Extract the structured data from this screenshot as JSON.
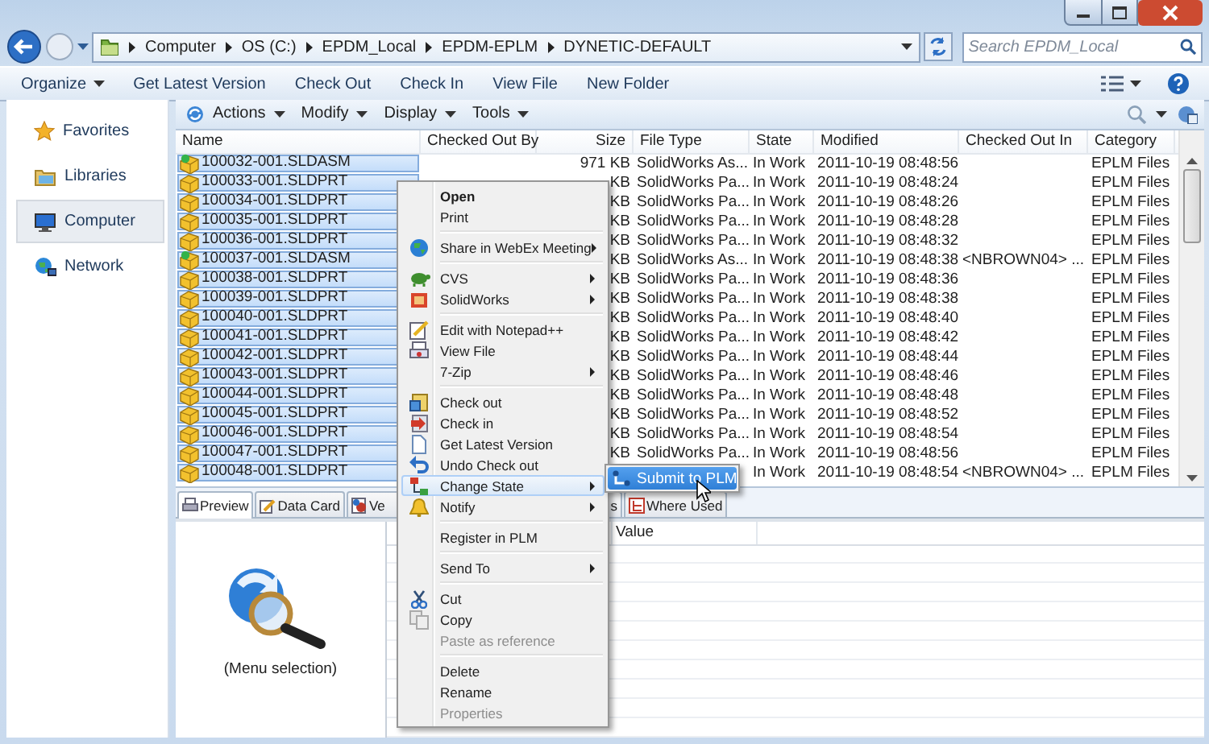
{
  "window": {
    "breadcrumb": [
      "Computer",
      "OS (C:)",
      "EPDM_Local",
      "EPDM-EPLM",
      "DYNETIC-DEFAULT"
    ],
    "search": {
      "placeholder": "Search EPDM_Local"
    }
  },
  "command_bar": [
    {
      "label": "Organize",
      "dropdown": true
    },
    {
      "label": "Get Latest Version",
      "dropdown": false
    },
    {
      "label": "Check Out",
      "dropdown": false
    },
    {
      "label": "Check In",
      "dropdown": false
    },
    {
      "label": "View File",
      "dropdown": false
    },
    {
      "label": "New Folder",
      "dropdown": false
    }
  ],
  "nav": [
    {
      "label": "Favorites",
      "selected": false
    },
    {
      "label": "Libraries",
      "selected": false
    },
    {
      "label": "Computer",
      "selected": true
    },
    {
      "label": "Network",
      "selected": false
    }
  ],
  "pdm_toolbar": [
    "Actions",
    "Modify",
    "Display",
    "Tools"
  ],
  "table": {
    "columns": [
      "Name",
      "Checked Out By",
      "Size",
      "File Type",
      "State",
      "Modified",
      "Checked Out In",
      "Category"
    ],
    "rows": [
      {
        "name": "100032-001.SLDASM",
        "kind": "assembly",
        "selected": true,
        "size": "971 KB",
        "file_type": "SolidWorks As...",
        "state": "In Work",
        "modified": "2011-10-19 08:48:56",
        "category": "EPLM Files"
      },
      {
        "name": "100033-001.SLDPRT",
        "kind": "part",
        "selected": true,
        "size": "KB",
        "file_type": "SolidWorks Pa...",
        "state": "In Work",
        "modified": "2011-10-19 08:48:24",
        "category": "EPLM Files"
      },
      {
        "name": "100034-001.SLDPRT",
        "kind": "part",
        "selected": true,
        "size": "KB",
        "file_type": "SolidWorks Pa...",
        "state": "In Work",
        "modified": "2011-10-19 08:48:26",
        "category": "EPLM Files"
      },
      {
        "name": "100035-001.SLDPRT",
        "kind": "part",
        "selected": true,
        "size": "KB",
        "file_type": "SolidWorks Pa...",
        "state": "In Work",
        "modified": "2011-10-19 08:48:28",
        "category": "EPLM Files"
      },
      {
        "name": "100036-001.SLDPRT",
        "kind": "part",
        "selected": true,
        "size": "KB",
        "file_type": "SolidWorks Pa...",
        "state": "In Work",
        "modified": "2011-10-19 08:48:32",
        "category": "EPLM Files"
      },
      {
        "name": "100037-001.SLDASM",
        "kind": "assembly",
        "selected": true,
        "size": "KB",
        "file_type": "SolidWorks As...",
        "state": "In Work",
        "modified": "2011-10-19 08:48:38",
        "checked_out_in": "<NBROWN04> ...",
        "category": "EPLM Files"
      },
      {
        "name": "100038-001.SLDPRT",
        "kind": "part",
        "selected": true,
        "size": "KB",
        "file_type": "SolidWorks Pa...",
        "state": "In Work",
        "modified": "2011-10-19 08:48:36",
        "category": "EPLM Files"
      },
      {
        "name": "100039-001.SLDPRT",
        "kind": "part",
        "selected": true,
        "size": "KB",
        "file_type": "SolidWorks Pa...",
        "state": "In Work",
        "modified": "2011-10-19 08:48:38",
        "category": "EPLM Files"
      },
      {
        "name": "100040-001.SLDPRT",
        "kind": "part",
        "selected": true,
        "size": "KB",
        "file_type": "SolidWorks Pa...",
        "state": "In Work",
        "modified": "2011-10-19 08:48:40",
        "category": "EPLM Files"
      },
      {
        "name": "100041-001.SLDPRT",
        "kind": "part",
        "selected": true,
        "size": "KB",
        "file_type": "SolidWorks Pa...",
        "state": "In Work",
        "modified": "2011-10-19 08:48:42",
        "category": "EPLM Files"
      },
      {
        "name": "100042-001.SLDPRT",
        "kind": "part",
        "selected": true,
        "size": "KB",
        "file_type": "SolidWorks Pa...",
        "state": "In Work",
        "modified": "2011-10-19 08:48:44",
        "category": "EPLM Files"
      },
      {
        "name": "100043-001.SLDPRT",
        "kind": "part",
        "selected": true,
        "size": "KB",
        "file_type": "SolidWorks Pa...",
        "state": "In Work",
        "modified": "2011-10-19 08:48:46",
        "category": "EPLM Files"
      },
      {
        "name": "100044-001.SLDPRT",
        "kind": "part",
        "selected": true,
        "size": "KB",
        "file_type": "SolidWorks Pa...",
        "state": "In Work",
        "modified": "2011-10-19 08:48:48",
        "category": "EPLM Files"
      },
      {
        "name": "100045-001.SLDPRT",
        "kind": "part",
        "selected": true,
        "size": "KB",
        "file_type": "SolidWorks Pa...",
        "state": "In Work",
        "modified": "2011-10-19 08:48:52",
        "category": "EPLM Files"
      },
      {
        "name": "100046-001.SLDPRT",
        "kind": "part",
        "selected": true,
        "size": "KB",
        "file_type": "SolidWorks Pa...",
        "state": "In Work",
        "modified": "2011-10-19 08:48:54",
        "category": "EPLM Files"
      },
      {
        "name": "100047-001.SLDPRT",
        "kind": "part",
        "selected": true,
        "size": "KB",
        "file_type": "SolidWorks Pa...",
        "state": "In Work",
        "modified": "2011-10-19 08:48:56",
        "category": "EPLM Files"
      },
      {
        "name": "100048-001.SLDPRT",
        "kind": "part",
        "selected": true,
        "state": "In Work",
        "modified": "2011-10-19 08:48:54",
        "checked_out_in": "<NBROWN04> ...",
        "category": "EPLM Files"
      }
    ]
  },
  "bottom_panel": {
    "tabs": [
      {
        "label": "Preview",
        "selected": true
      },
      {
        "label": "Data Card",
        "selected": false
      },
      {
        "label": "Ve",
        "selected": false
      },
      {
        "label": "s",
        "selected": false
      },
      {
        "label": "Where Used",
        "selected": false
      }
    ],
    "preview_caption": "(Menu selection)",
    "value_column": "Value"
  },
  "context_menu": {
    "groups": [
      [
        {
          "label": "Open",
          "default": true,
          "disabled": false,
          "submenu": false,
          "selected": false
        },
        {
          "label": "Print",
          "default": false,
          "disabled": false,
          "submenu": false,
          "selected": false
        }
      ],
      [
        {
          "label": "Share in WebEx Meeting",
          "default": false,
          "disabled": false,
          "submenu": true,
          "selected": false
        }
      ],
      [
        {
          "label": "CVS",
          "default": false,
          "disabled": false,
          "submenu": true,
          "selected": false
        },
        {
          "label": "SolidWorks",
          "default": false,
          "disabled": false,
          "submenu": true,
          "selected": false
        }
      ],
      [
        {
          "label": "Edit with Notepad++",
          "default": false,
          "disabled": false,
          "submenu": false,
          "selected": false
        },
        {
          "label": "View File",
          "default": false,
          "disabled": false,
          "submenu": false,
          "selected": false
        },
        {
          "label": "7-Zip",
          "default": false,
          "disabled": false,
          "submenu": true,
          "selected": false
        }
      ],
      [
        {
          "label": "Check out",
          "default": false,
          "disabled": false,
          "submenu": false,
          "selected": false
        },
        {
          "label": "Check in",
          "default": false,
          "disabled": false,
          "submenu": false,
          "selected": false
        },
        {
          "label": "Get Latest Version",
          "default": false,
          "disabled": false,
          "submenu": false,
          "selected": false
        },
        {
          "label": "Undo Check out",
          "default": false,
          "disabled": false,
          "submenu": false,
          "selected": false
        },
        {
          "label": "Change State",
          "default": false,
          "disabled": false,
          "submenu": true,
          "selected": true
        },
        {
          "label": "Notify",
          "default": false,
          "disabled": false,
          "submenu": true,
          "selected": false
        }
      ],
      [
        {
          "label": "Register in PLM",
          "default": false,
          "disabled": false,
          "submenu": false,
          "selected": false
        }
      ],
      [
        {
          "label": "Send To",
          "default": false,
          "disabled": false,
          "submenu": true,
          "selected": false
        }
      ],
      [
        {
          "label": "Cut",
          "default": false,
          "disabled": false,
          "submenu": false,
          "selected": false
        },
        {
          "label": "Copy",
          "default": false,
          "disabled": false,
          "submenu": false,
          "selected": false
        },
        {
          "label": "Paste as reference",
          "default": false,
          "disabled": true,
          "submenu": false,
          "selected": false
        }
      ],
      [
        {
          "label": "Delete",
          "default": false,
          "disabled": false,
          "submenu": false,
          "selected": false
        },
        {
          "label": "Rename",
          "default": false,
          "disabled": false,
          "submenu": false,
          "selected": false
        },
        {
          "label": "Properties",
          "default": false,
          "disabled": true,
          "submenu": false,
          "selected": false
        }
      ]
    ]
  },
  "submenu": {
    "items": [
      {
        "label": "Submit to PLM",
        "selected": true
      }
    ]
  }
}
